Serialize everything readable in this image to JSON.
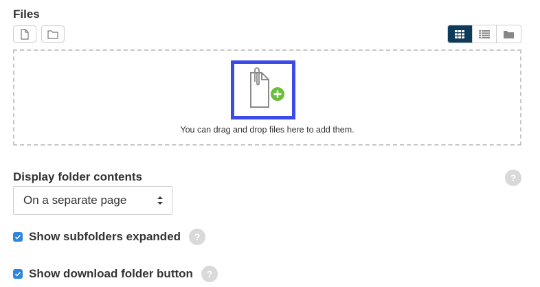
{
  "files_section": {
    "label": "Files",
    "add_file_icon": "file-icon",
    "create_folder_icon": "folder-icon",
    "view_modes": [
      "grid-view-icon",
      "list-view-icon",
      "folder-tree-icon"
    ],
    "active_view": "grid-view-icon",
    "dropzone_text": "You can drag and drop files here to add them.",
    "add_badge_color": "#6cbf3e",
    "highlight_color": "#3b4be8"
  },
  "display_contents": {
    "label": "Display folder contents",
    "selected": "On a separate page"
  },
  "options": [
    {
      "label": "Show subfolders expanded",
      "checked": true
    },
    {
      "label": "Show download folder button",
      "checked": true
    }
  ],
  "help_text": "?"
}
